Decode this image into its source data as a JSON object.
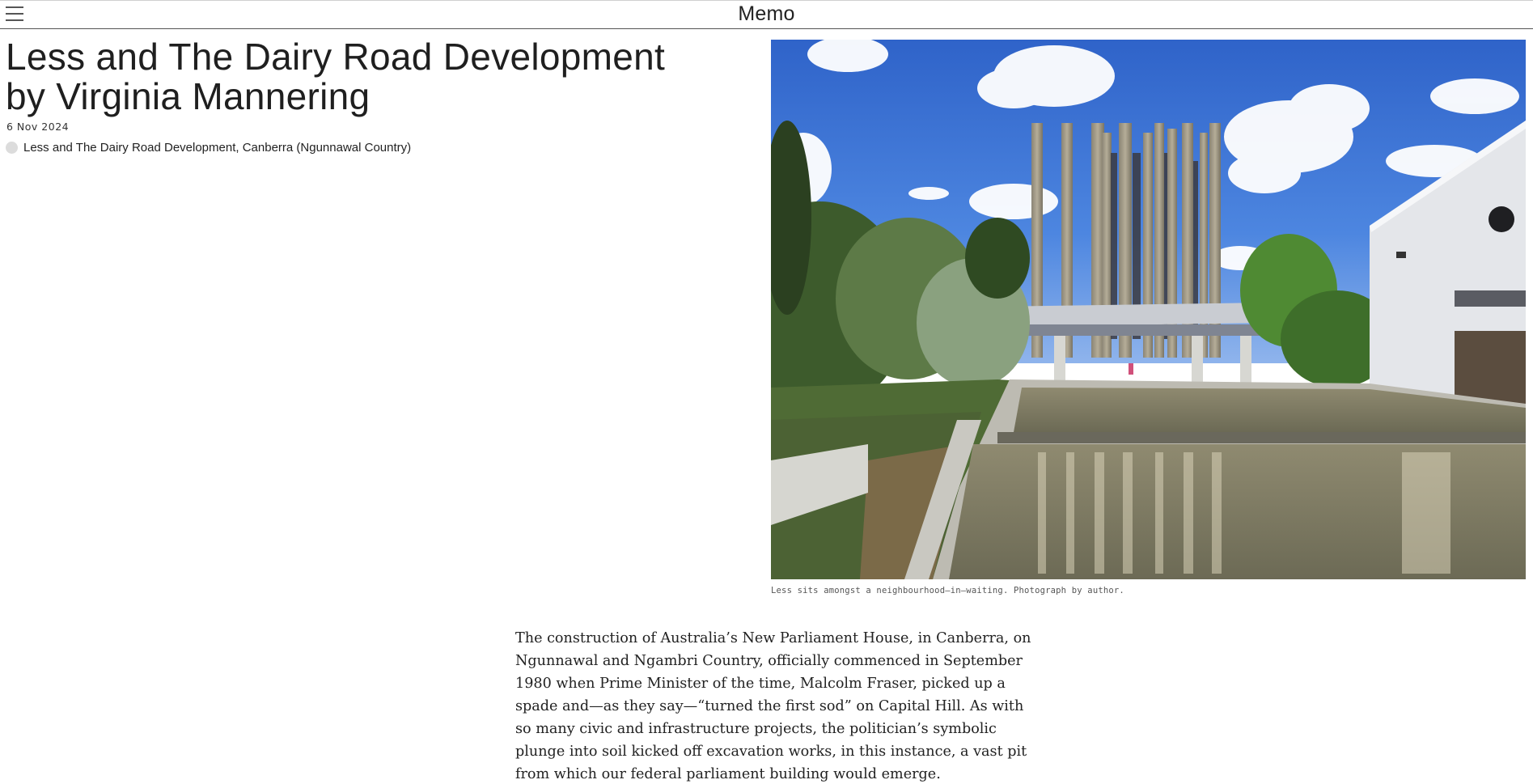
{
  "header": {
    "brand": "Memo",
    "menu_icon": "hamburger-menu-icon"
  },
  "article": {
    "title": "Less and The Dairy Road Development by Virginia Mannering",
    "date": "6 Nov 2024",
    "location": "Less and The Dairy Road Development, Canberra (Ngunnawal Country)",
    "location_icon": "location-dot-icon",
    "image_caption": "Less sits amongst a neighbourhood—in—waiting. Photograph by author.",
    "body": "The construction of Australia’s New Parliament House, in Canberra, on Ngunnawal and Ngambri Country, officially commenced in September 1980 when Prime Minister of the time, Malcolm Fraser, picked up a spade and—as they say—“turned the first sod” on Capital Hill. As with so many civic and infrastructure projects, the politician’s symbolic plunge into soil kicked off excavation works, in this instance, a vast pit from which our federal parliament building would emerge."
  },
  "colors": {
    "sky": "#3a72d8",
    "text": "#222222",
    "divider": "#555555"
  }
}
